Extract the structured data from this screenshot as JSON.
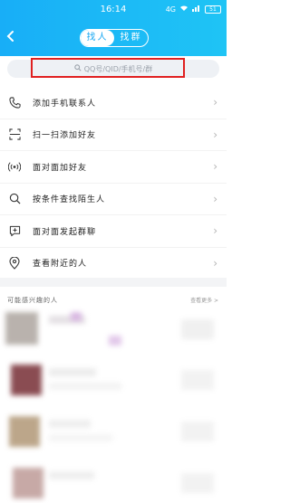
{
  "status_bar": {
    "time": "16:14",
    "network": "4G",
    "battery": "51"
  },
  "header": {
    "tabs": [
      {
        "label": "找人",
        "active": true
      },
      {
        "label": "找群",
        "active": false
      }
    ]
  },
  "search": {
    "placeholder": "QQ号/QID/手机号/群"
  },
  "menu": {
    "items": [
      {
        "label": "添加手机联系人",
        "icon": "phone-icon"
      },
      {
        "label": "扫一扫添加好友",
        "icon": "scan-icon"
      },
      {
        "label": "面对面加好友",
        "icon": "radar-icon"
      },
      {
        "label": "按条件查找陌生人",
        "icon": "search-icon"
      },
      {
        "label": "面对面发起群聊",
        "icon": "group-chat-icon"
      },
      {
        "label": "查看附近的人",
        "icon": "location-pin-icon"
      }
    ]
  },
  "people_section": {
    "title": "可能感兴趣的人",
    "more": "查看更多 >"
  },
  "colors": {
    "brand": "#1aa8f2",
    "highlight": "#e02020"
  }
}
